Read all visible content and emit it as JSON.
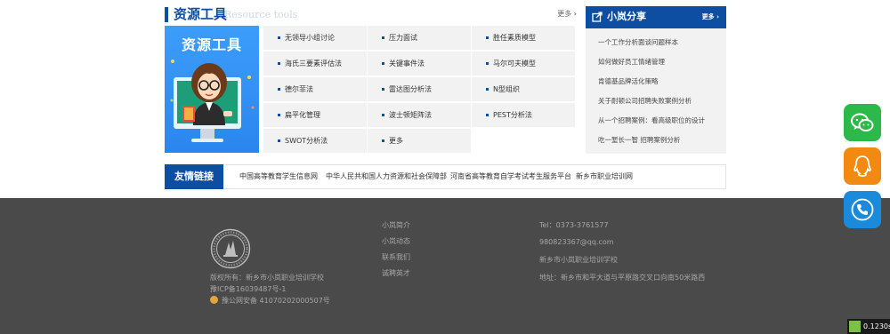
{
  "resources": {
    "title": "资源工具",
    "subtitle": "Resource tools",
    "more_label": "更多",
    "banner_title": "资源工具",
    "items": [
      "无领导小组讨论",
      "压力面试",
      "胜任素质模型",
      "海氏三要素评估法",
      "关键事件法",
      "马尔可夫模型",
      "德尔菲法",
      "雷达图分析法",
      "N型组织",
      "扁平化管理",
      "波士顿矩阵法",
      "PEST分析法",
      "SWOT分析法",
      "更多"
    ]
  },
  "share": {
    "title": "小岚分享",
    "more_label": "更多",
    "items": [
      "一个工作分析面谈问题样本",
      "如何做好员工情绪管理",
      "肯德基品牌活化策略",
      "关于耐顿公司招聘失败案例分析",
      "从一个招聘案例：看高级职位的设计",
      "吃一堑长一智 招聘案例分析"
    ]
  },
  "friends": {
    "title": "友情链接",
    "links": [
      "中国高等教育学生信息网",
      "中华人民共和国人力资源和社会保障部",
      "河南省高等教育自学考试考生服务平台",
      "新乡市职业培训网"
    ]
  },
  "footer": {
    "copyright": "版权所有：新乡市小岚职业培训学校",
    "icp": "豫ICP备16039487号-1",
    "police": "豫公网安备 41070202000507号",
    "nav": [
      "小岚简介",
      "小岚动态",
      "联系我们",
      "诚聘英才"
    ],
    "contact": {
      "tel": "Tel：0373-3761577",
      "email": "980823367@qq.com",
      "school": "新乡市小岚职业培训学校",
      "address": "地址：新乡市和平大道与平原路交叉口向南50米路西"
    }
  },
  "floating": {
    "wechat_icon": "wechat-icon",
    "qq_icon": "qq-icon",
    "phone_icon": "phone-icon"
  },
  "timer": {
    "value": "0.1230s"
  },
  "colors": {
    "brand": "#0e4ea2",
    "footer_bg": "#4a4a4a",
    "wechat": "#2db84a",
    "qq": "#f28a12",
    "phone": "#1c8adb"
  }
}
